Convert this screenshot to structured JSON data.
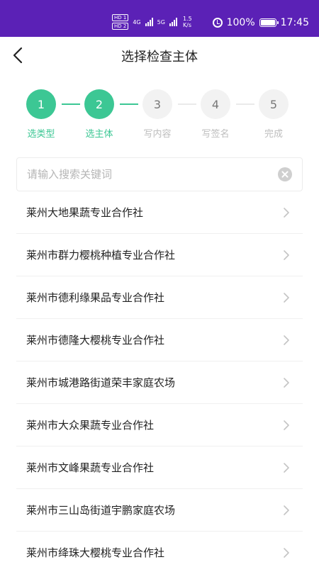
{
  "status_bar": {
    "hd1": "HD 1",
    "hd2": "HD 2",
    "net1": "4G",
    "net2": "5G",
    "speed_value": "1.5",
    "speed_unit": "K/s",
    "battery": "100%",
    "time": "17:45"
  },
  "header": {
    "title": "选择检查主体"
  },
  "stepper": {
    "steps": [
      {
        "number": "1",
        "label": "选类型",
        "state": "done"
      },
      {
        "number": "2",
        "label": "选主体",
        "state": "active"
      },
      {
        "number": "3",
        "label": "写内容",
        "state": "todo"
      },
      {
        "number": "4",
        "label": "写签名",
        "state": "todo"
      },
      {
        "number": "5",
        "label": "完成",
        "state": "todo"
      }
    ]
  },
  "search": {
    "placeholder": "请输入搜索关键词",
    "value": ""
  },
  "list": {
    "items": [
      "莱州大地果蔬专业合作社",
      "莱州市群力樱桃种植专业合作社",
      "莱州市德利缘果品专业合作社",
      "莱州市德隆大樱桃专业合作社",
      "莱州市城港路街道荣丰家庭农场",
      "莱州市大众果蔬专业合作社",
      "莱州市文峰果蔬专业合作社",
      "莱州市三山岛街道宇鹏家庭农场",
      "莱州市绛珠大樱桃专业合作社"
    ]
  },
  "colors": {
    "status_bar": "#5b21b6",
    "accent": "#3cc794",
    "inactive": "#bdbdbd"
  }
}
